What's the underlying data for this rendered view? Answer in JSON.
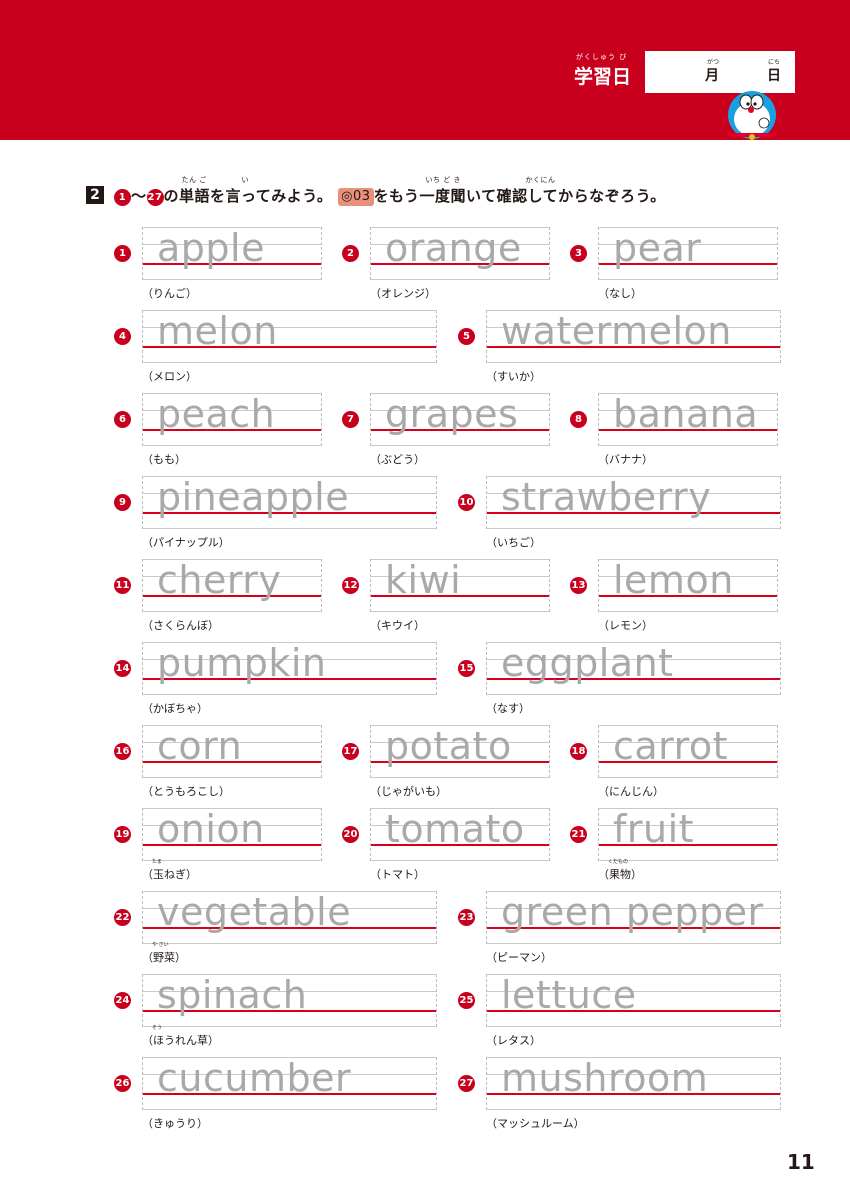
{
  "header": {
    "study_day_ruby": "がくしゅう び",
    "study_day_label": "学習日",
    "month_ruby": "がつ",
    "month_label": "月",
    "day_ruby": "にち",
    "day_label": "日",
    "mascot": "doraemon-character-icon",
    "accent_color": "#c8001e"
  },
  "instruction": {
    "number": "2",
    "range_start": "1",
    "range_end": "27",
    "text_part1": "の単語を言ってみよう。",
    "ruby_tango": "たん ご",
    "ruby_i": "い",
    "audio_icon": "audio-track-icon",
    "audio_track": "03",
    "text_part2": "をもう一度聞いて確認してからなぞろう。",
    "ruby_ichidoki": "いち ど き",
    "ruby_kakunin": "かくにん"
  },
  "items": [
    {
      "num": "1",
      "word": "apple",
      "meaning": "（りんご）"
    },
    {
      "num": "2",
      "word": "orange",
      "meaning": "（オレンジ）"
    },
    {
      "num": "3",
      "word": "pear",
      "meaning": "（なし）"
    },
    {
      "num": "4",
      "word": "melon",
      "meaning": "（メロン）"
    },
    {
      "num": "5",
      "word": "watermelon",
      "meaning": "（すいか）"
    },
    {
      "num": "6",
      "word": "peach",
      "meaning": "（もも）"
    },
    {
      "num": "7",
      "word": "grapes",
      "meaning": "（ぶどう）"
    },
    {
      "num": "8",
      "word": "banana",
      "meaning": "（バナナ）"
    },
    {
      "num": "9",
      "word": "pineapple",
      "meaning": "（パイナップル）"
    },
    {
      "num": "10",
      "word": "strawberry",
      "meaning": "（いちご）"
    },
    {
      "num": "11",
      "word": "cherry",
      "meaning": "（さくらんぼ）"
    },
    {
      "num": "12",
      "word": "kiwi",
      "meaning": "（キウイ）"
    },
    {
      "num": "13",
      "word": "lemon",
      "meaning": "（レモン）"
    },
    {
      "num": "14",
      "word": "pumpkin",
      "meaning": "（かぼちゃ）"
    },
    {
      "num": "15",
      "word": "eggplant",
      "meaning": "（なす）"
    },
    {
      "num": "16",
      "word": "corn",
      "meaning": "（とうもろこし）"
    },
    {
      "num": "17",
      "word": "potato",
      "meaning": "（じゃがいも）"
    },
    {
      "num": "18",
      "word": "carrot",
      "meaning": "（にんじん）"
    },
    {
      "num": "19",
      "word": "onion",
      "meaning": "（玉ねぎ）",
      "ruby": "たま"
    },
    {
      "num": "20",
      "word": "tomato",
      "meaning": "（トマト）"
    },
    {
      "num": "21",
      "word": "fruit",
      "meaning": "（果物）",
      "ruby": "くだもの"
    },
    {
      "num": "22",
      "word": "vegetable",
      "meaning": "（野菜）",
      "ruby": "や さい"
    },
    {
      "num": "23",
      "word": "green pepper",
      "meaning": "（ピーマン）"
    },
    {
      "num": "24",
      "word": "spinach",
      "meaning": "（ほうれん草）",
      "ruby": "そう"
    },
    {
      "num": "25",
      "word": "lettuce",
      "meaning": "（レタス）"
    },
    {
      "num": "26",
      "word": "cucumber",
      "meaning": "（きゅうり）"
    },
    {
      "num": "27",
      "word": "mushroom",
      "meaning": "（マッシュルーム）"
    }
  ],
  "page_number": "11"
}
